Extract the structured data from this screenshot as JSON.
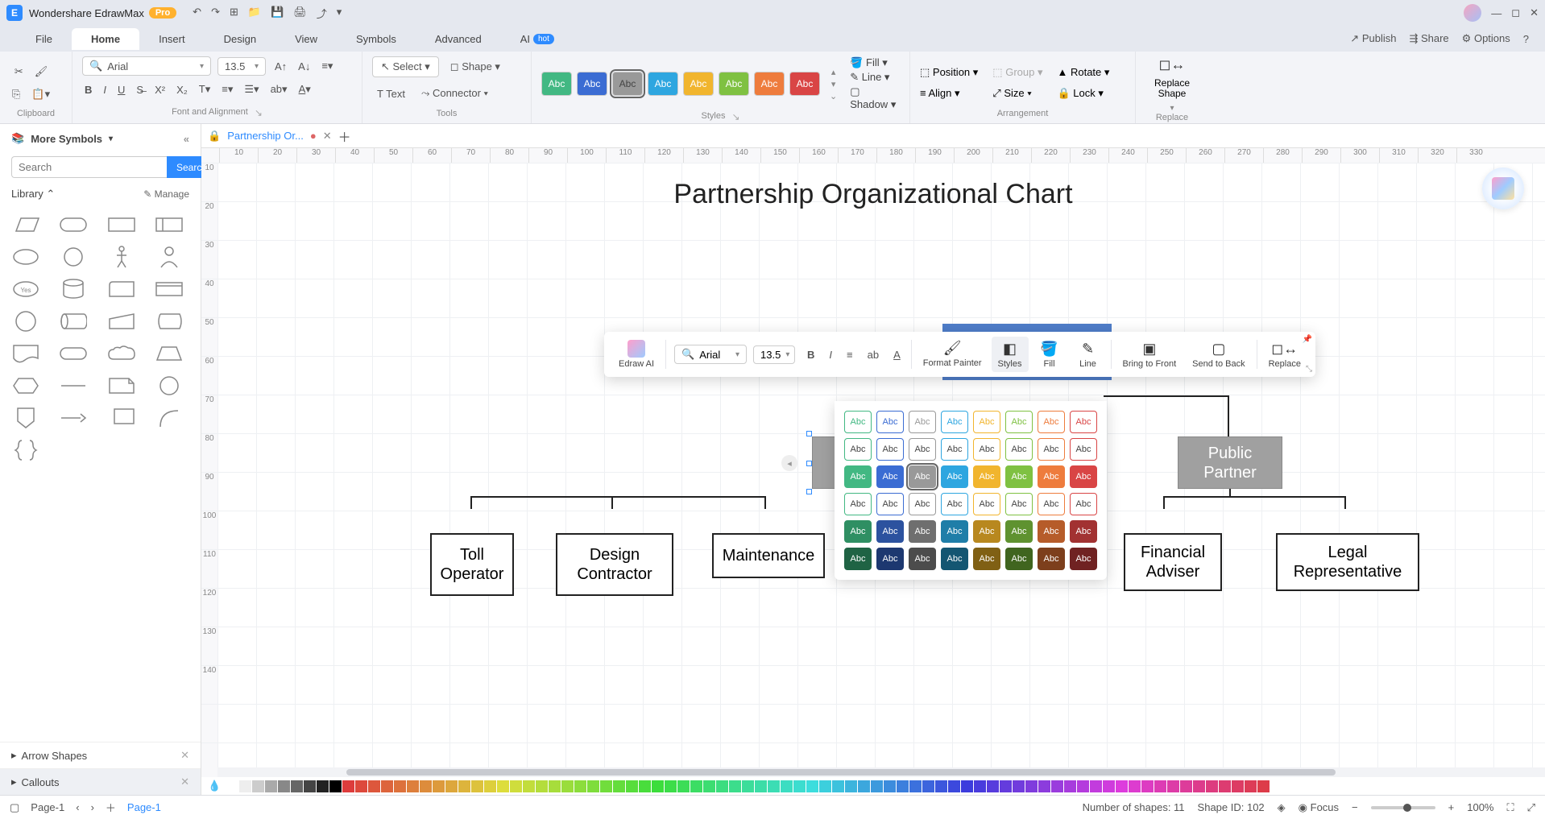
{
  "app": {
    "name": "Wondershare EdrawMax",
    "badge": "Pro"
  },
  "menu": {
    "file": "File",
    "home": "Home",
    "insert": "Insert",
    "design": "Design",
    "view": "View",
    "symbols": "Symbols",
    "advanced": "Advanced",
    "ai": "AI",
    "hot": "hot",
    "publish": "Publish",
    "share": "Share",
    "options": "Options"
  },
  "ribbon": {
    "font": "Arial",
    "fontSize": "13.5",
    "clipboard": "Clipboard",
    "fontAlign": "Font and Alignment",
    "tools": "Tools",
    "styles": "Styles",
    "arrangement": "Arrangement",
    "replace": "Replace",
    "select": "Select",
    "text": "Text",
    "shape": "Shape",
    "connector": "Connector",
    "fill": "Fill",
    "line": "Line",
    "shadow": "Shadow",
    "position": "Position",
    "align": "Align",
    "group": "Group",
    "size": "Size",
    "rotate": "Rotate",
    "lock": "Lock",
    "replaceShape": "Replace Shape",
    "abc": "Abc"
  },
  "sidebar": {
    "moreSymbols": "More Symbols",
    "searchPlaceholder": "Search",
    "searchBtn": "Search",
    "library": "Library",
    "manage": "Manage",
    "arrowShapes": "Arrow Shapes",
    "callouts": "Callouts"
  },
  "docTab": {
    "name": "Partnership Or..."
  },
  "canvas": {
    "title": "Partnership Organizational Chart",
    "box1": "Toll Operator",
    "box2": "Design Contractor",
    "box3": "Maintenance",
    "box4": "Public Partner",
    "box5": "Financial Adviser",
    "box6": "Legal Representative"
  },
  "floatTb": {
    "font": "Arial",
    "fontSize": "13.5",
    "edrawAI": "Edraw AI",
    "formatPainter": "Format Painter",
    "styles": "Styles",
    "fill": "Fill",
    "line": "Line",
    "bringFront": "Bring to Front",
    "sendBack": "Send to Back",
    "replace": "Replace",
    "abc": "Abc"
  },
  "status": {
    "page": "Page-1",
    "pageTab": "Page-1",
    "numShapes": "Number of shapes: 11",
    "shapeId": "Shape ID: 102",
    "focus": "Focus",
    "zoom": "100%"
  },
  "rulerH": [
    "10",
    "20",
    "30",
    "40",
    "50",
    "60",
    "70",
    "80",
    "90",
    "100",
    "110",
    "120",
    "130",
    "140",
    "150",
    "160",
    "170",
    "180",
    "190",
    "200",
    "210",
    "220",
    "230",
    "240",
    "250",
    "260",
    "270",
    "280",
    "290",
    "300",
    "310",
    "320",
    "330"
  ],
  "rulerV": [
    "10",
    "20",
    "30",
    "40",
    "50",
    "60",
    "70",
    "80",
    "90",
    "100",
    "110",
    "120",
    "130",
    "140"
  ]
}
